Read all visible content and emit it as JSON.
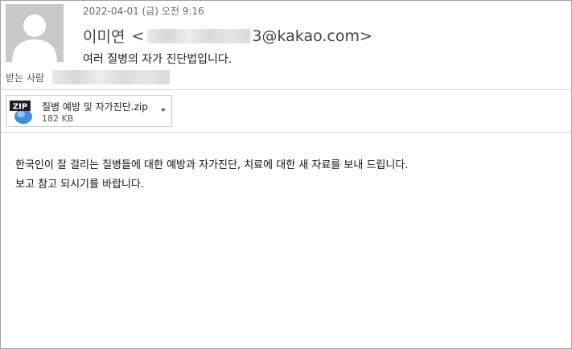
{
  "message": {
    "date": "2022-04-01 (금) 오전 9:16",
    "sender_name": "이미연",
    "sender_email_open": "<",
    "sender_email_domain": "3@kakao.com>",
    "subject": "여러 질병의 자가 진단법입니다.",
    "recipient_label": "받는 사람"
  },
  "attachment": {
    "icon": "zip-file-icon",
    "icon_label": "ZIP",
    "name": "질병 예방 및 자가진단.zip",
    "size": "182 KB"
  },
  "body": {
    "lines": [
      "한국인이 잘 걸리는 질병들에 대한 예방과 자가진단, 치료에 대한 새 자료를 보내 드립니다.",
      "보고 참고 되시기를 바랍니다."
    ]
  },
  "colors": {
    "avatar_bg": "#c8c8c8",
    "avatar_fg": "#ffffff",
    "zip_label_bg": "#1f1f1f",
    "zip_body": "#3f8ede"
  }
}
